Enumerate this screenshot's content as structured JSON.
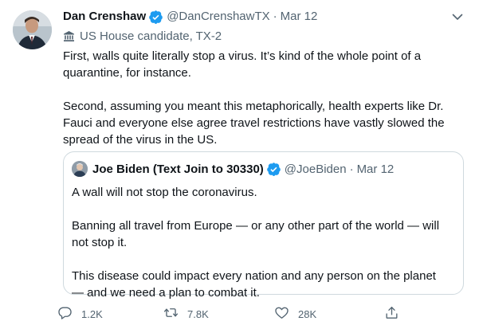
{
  "tweet": {
    "author_name": "Dan Crenshaw",
    "author_handle": "@DanCrenshawTX",
    "separator": "·",
    "date": "Mar 12",
    "label": "US House candidate, TX-2",
    "body": [
      "First, walls quite literally stop a virus. It’s kind of the whole point of a quarantine, for instance.",
      "Second, assuming you meant this metaphorically, health experts like Dr. Fauci and everyone else agree travel restrictions have vastly slowed the spread of the virus in the US."
    ]
  },
  "quoted": {
    "author_name": "Joe Biden (Text Join to 30330)",
    "author_handle": "@JoeBiden",
    "separator": "·",
    "date": "Mar 12",
    "body": [
      "A wall will not stop the coronavirus.",
      "Banning all travel from Europe — or any other part of the world — will not stop it.",
      "This disease could impact every nation and any person on the planet — and we need a plan to combat it."
    ]
  },
  "actions": {
    "reply_count": "1.2K",
    "retweet_count": "7.8K",
    "like_count": "28K"
  },
  "colors": {
    "verified": "#1d9bf0",
    "muted": "#536471",
    "border": "#cfd9de"
  },
  "icons": [
    "chevron-down-icon",
    "verified-badge-icon",
    "government-building-icon",
    "reply-icon",
    "retweet-icon",
    "like-icon",
    "share-icon"
  ]
}
